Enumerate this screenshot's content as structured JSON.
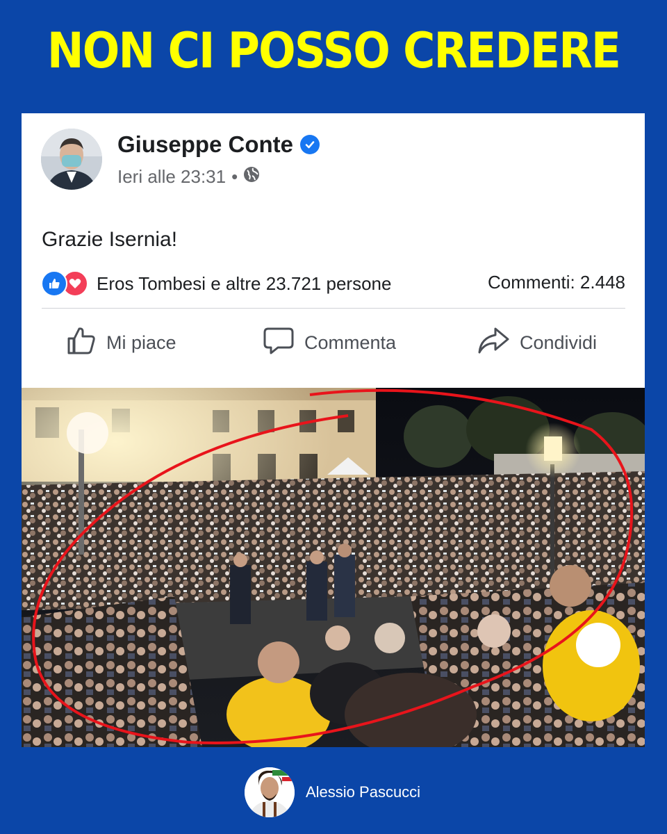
{
  "headline": "NON CI POSSO CREDERE",
  "post": {
    "author": "Giuseppe Conte",
    "timestamp": "Ieri alle 23:31",
    "separator": "•",
    "text": "Grazie Isernia!",
    "reactions_text": "Eros Tombesi e altre 23.721 persone",
    "comments_text": "Commenti: 2.448"
  },
  "actions": {
    "like": "Mi piace",
    "comment": "Commenta",
    "share": "Condividi"
  },
  "icons": {
    "verified": "verified-badge-icon",
    "audience": "globe-icon",
    "like_reaction": "thumbs-up-icon",
    "love_reaction": "heart-icon",
    "like_action": "thumbs-up-outline-icon",
    "comment_action": "speech-bubble-icon",
    "share_action": "share-arrow-icon"
  },
  "colors": {
    "background": "#0b46a8",
    "headline": "#ffff00",
    "facebook_blue": "#1877f2",
    "love_red": "#f33e58",
    "annotation_red": "#e8141b"
  },
  "footer": {
    "name": "Alessio Pascucci"
  }
}
